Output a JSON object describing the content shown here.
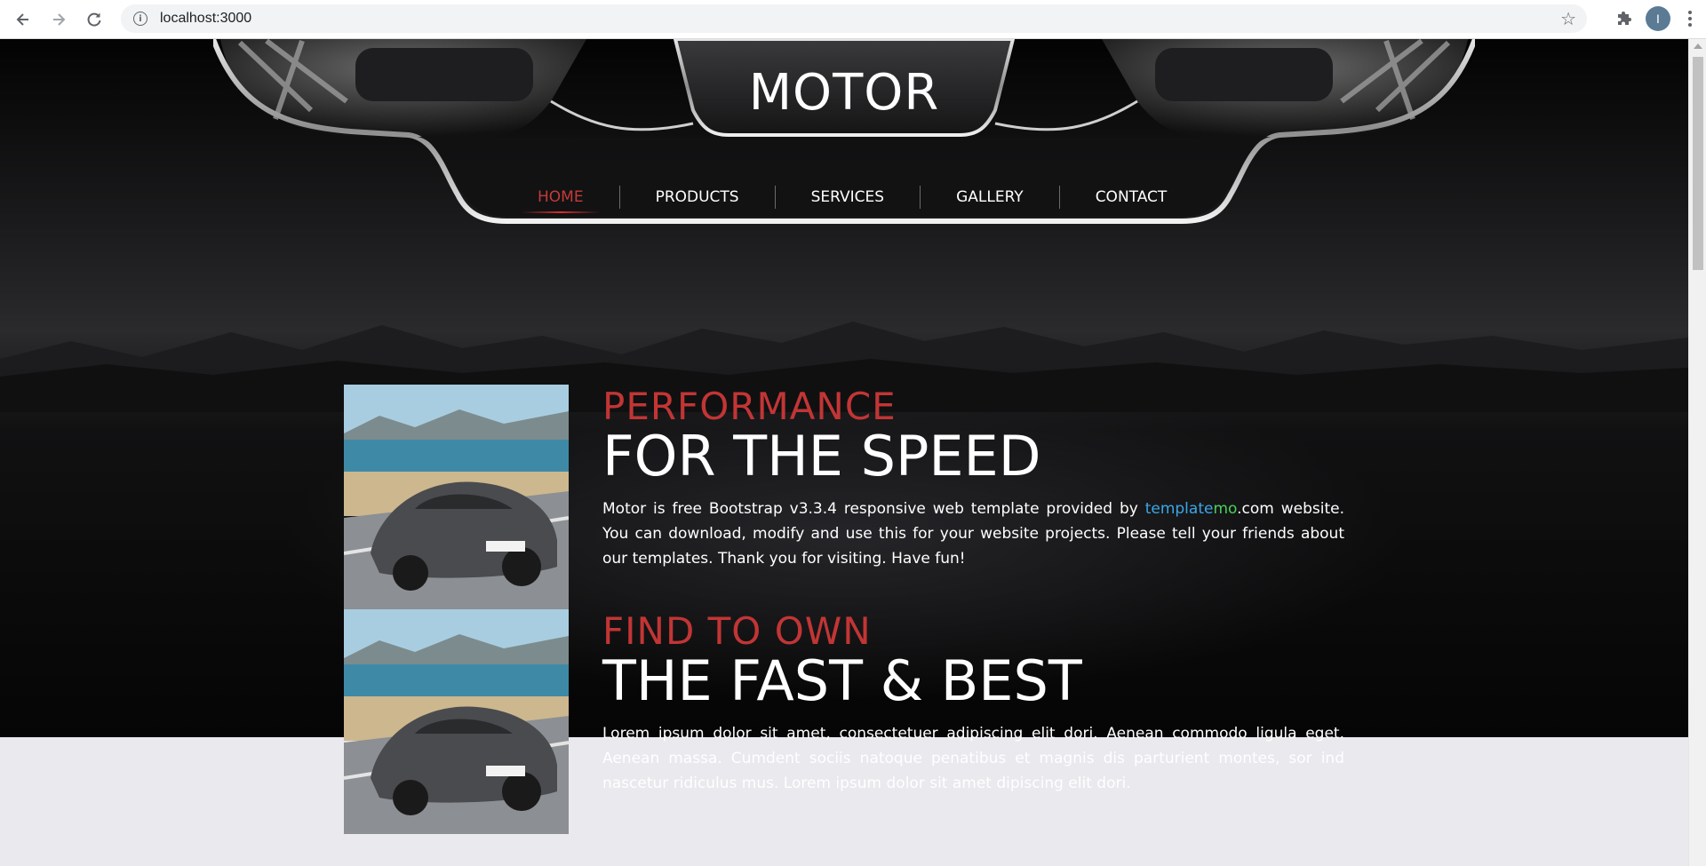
{
  "browser": {
    "url": "localhost:3000",
    "info_icon": "info-icon",
    "profile_initial": "I",
    "icons": [
      "back-arrow-icon",
      "forward-arrow-icon",
      "reload-icon",
      "star-icon",
      "extensions-puzzle-icon",
      "menu-kebab-icon"
    ]
  },
  "site": {
    "logo": "MOTOR",
    "nav": [
      {
        "label": "HOME",
        "active": true
      },
      {
        "label": "PRODUCTS",
        "active": false
      },
      {
        "label": "SERVICES",
        "active": false
      },
      {
        "label": "GALLERY",
        "active": false
      },
      {
        "label": "CONTACT",
        "active": false
      }
    ]
  },
  "blocks": [
    {
      "kicker": "PERFORMANCE",
      "headline": "FOR THE SPEED",
      "para_before": "Motor is free Bootstrap v3.3.4 responsive web template provided by ",
      "link_part1": "template",
      "link_part2": "mo",
      "para_after": ".com website. You can download, modify and use this for your website projects. Please tell your friends about our templates. Thank you for visiting. Have fun!"
    },
    {
      "kicker": "FIND TO OWN",
      "headline": "THE FAST & BEST",
      "para": "Lorem ipsum dolor sit amet, consectetuer adipiscing elit dori. Aenean commodo ligula eget. Aenean massa. Cumdent sociis natoque penatibus et magnis dis parturient montes, sor ind nascetur ridiculus mus. Lorem ipsum dolor sit amet dipiscing elit dori."
    }
  ],
  "colors": {
    "accent_red": "#c23535",
    "link_blue": "#3aa7e8",
    "link_green": "#4ad15a",
    "hero_bg": "#050505",
    "page_bg": "#e9e9ee"
  }
}
